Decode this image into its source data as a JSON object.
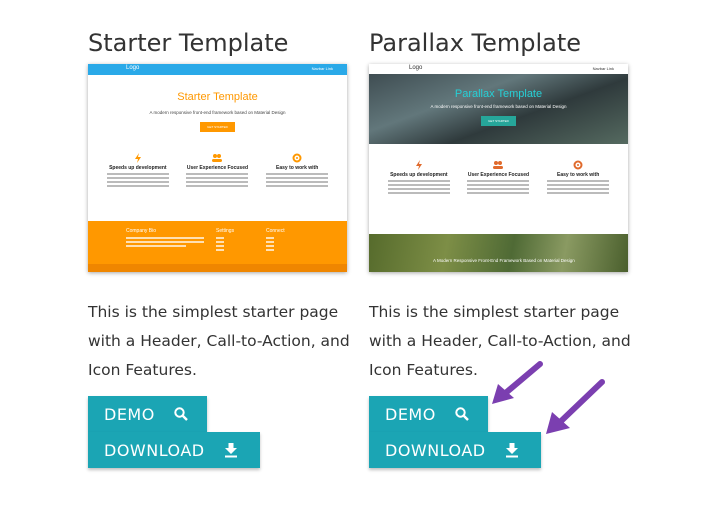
{
  "cards": [
    {
      "title": "Starter Template",
      "description": "This is the simplest starter page with a Header, Call-to-Action, and Icon Features.",
      "demo_label": "DEMO",
      "download_label": "DOWNLOAD",
      "thumbnail": {
        "nav_logo": "Logo",
        "nav_link": "Navbar Link",
        "hero_title": "Starter Template",
        "hero_subtitle": "A modern responsive front-end framework based on Material Design",
        "hero_button": "GET STARTED",
        "features": [
          "Speeds up development",
          "User Experience Focused",
          "Easy to work with"
        ],
        "footer_columns": [
          "Company Bio",
          "Settings",
          "Connect"
        ],
        "accent_color": "#ff9800"
      }
    },
    {
      "title": "Parallax Template",
      "description": "This is the simplest starter page with a Header, Call-to-Action, and Icon Features.",
      "demo_label": "DEMO",
      "download_label": "DOWNLOAD",
      "thumbnail": {
        "nav_logo": "Logo",
        "nav_link": "Navbar Link",
        "hero_title": "Parallax Template",
        "hero_subtitle": "A modern responsive front-end framework based on Material Design",
        "hero_button": "GET STARTED",
        "features": [
          "Speeds up development",
          "User Experience Focused",
          "Easy to work with"
        ],
        "footer_caption": "A Modern Responsive Front-End Framework Based on Material Design",
        "accent_color": "#26a69a"
      }
    }
  ],
  "colors": {
    "button": "#1ba5b4",
    "arrow": "#7b3fb0"
  },
  "icons": {
    "demo": "search-icon",
    "download": "download-icon"
  }
}
